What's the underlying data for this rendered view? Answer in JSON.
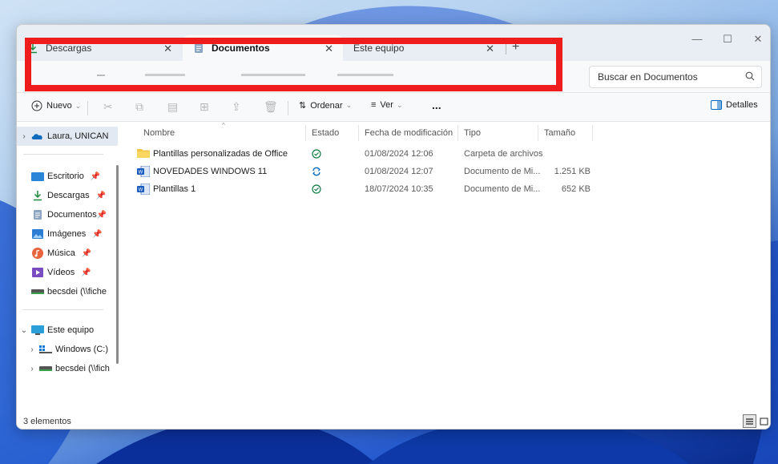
{
  "tabs": [
    {
      "label": "Descargas"
    },
    {
      "label": "Documentos"
    },
    {
      "label": "Este equipo"
    }
  ],
  "search": {
    "placeholder": "Buscar en Documentos"
  },
  "toolbar": {
    "new_label": "Nuevo",
    "sort_label": "Ordenar",
    "view_label": "Ver",
    "more_label": "...",
    "details_label": "Detalles"
  },
  "sidebar": {
    "items": [
      {
        "label": "Laura, UNICAN"
      },
      {
        "label": "Escritorio"
      },
      {
        "label": "Descargas"
      },
      {
        "label": "Documentos"
      },
      {
        "label": "Imágenes"
      },
      {
        "label": "Música"
      },
      {
        "label": "Vídeos"
      },
      {
        "label": "becsdei (\\\\fiche"
      },
      {
        "label": "Este equipo"
      },
      {
        "label": "Windows (C:)"
      },
      {
        "label": "becsdei (\\\\fich"
      }
    ]
  },
  "columns": [
    "Nombre",
    "Estado",
    "Fecha de modificación",
    "Tipo",
    "Tamaño"
  ],
  "files": [
    {
      "name": "Plantillas personalizadas de Office",
      "status": "synced",
      "date": "01/08/2024 12:06",
      "type": "Carpeta de archivos",
      "size": ""
    },
    {
      "name": "NOVEDADES WINDOWS 11",
      "status": "syncing",
      "date": "01/08/2024 12:07",
      "type": "Documento de Mi...",
      "size": "1.251 KB"
    },
    {
      "name": "Plantillas 1",
      "status": "synced",
      "date": "18/07/2024 10:35",
      "type": "Documento de Mi...",
      "size": "652 KB"
    }
  ],
  "status": {
    "count": "3 elementos"
  },
  "colors": {
    "highlight_border": "#ee1c1c",
    "accent": "#0067c0"
  }
}
